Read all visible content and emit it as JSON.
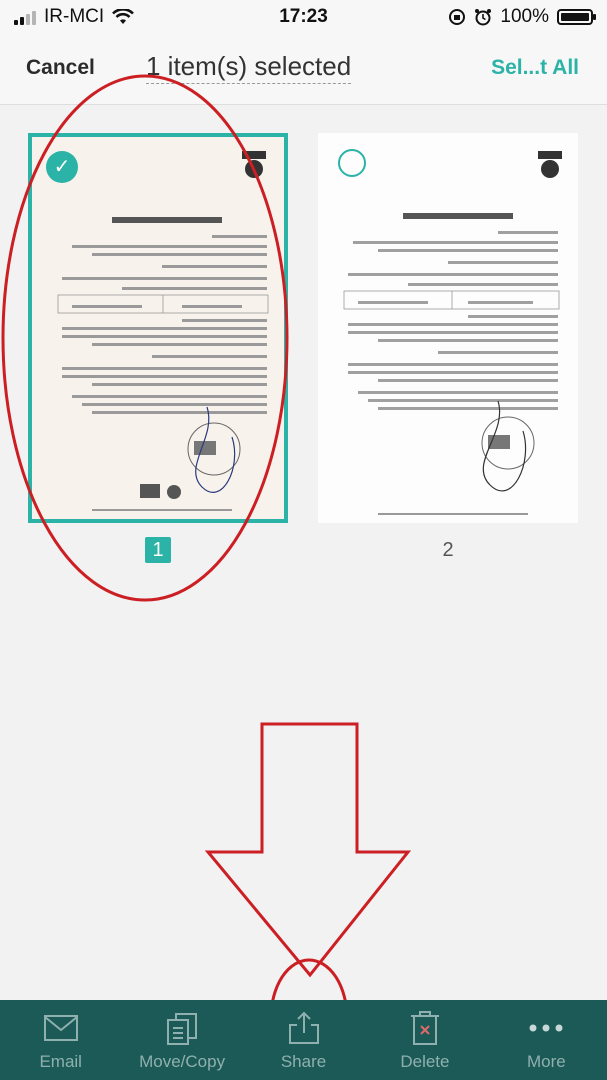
{
  "status_bar": {
    "carrier": "IR-MCI",
    "time": "17:23",
    "battery": "100%",
    "battery_level": 1.0
  },
  "nav": {
    "cancel_label": "Cancel",
    "title": "1 item(s) selected",
    "select_all_label": "Sel...t All"
  },
  "pages": [
    {
      "number": "1",
      "selected": true
    },
    {
      "number": "2",
      "selected": false
    }
  ],
  "toolbar": {
    "items": [
      {
        "label": "Email",
        "icon": "envelope-icon"
      },
      {
        "label": "Move/Copy",
        "icon": "copy-icon"
      },
      {
        "label": "Share",
        "icon": "share-icon"
      },
      {
        "label": "Delete",
        "icon": "trash-icon"
      },
      {
        "label": "More",
        "icon": "ellipsis-icon"
      }
    ]
  },
  "colors": {
    "accent": "#2ab3a6",
    "toolbar_bg": "#1b5a57",
    "annotation": "#cc1f24"
  }
}
